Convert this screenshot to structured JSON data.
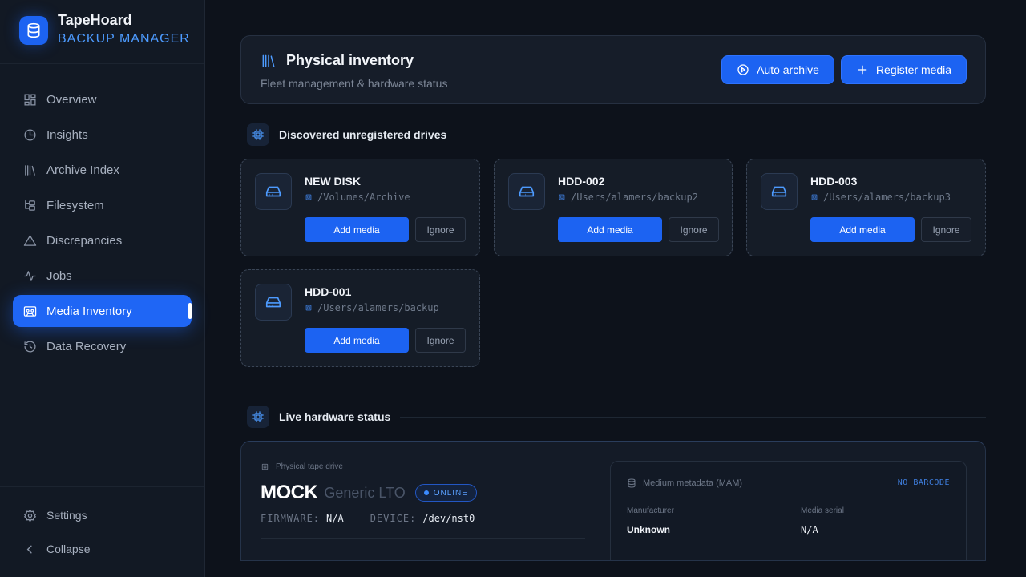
{
  "app": {
    "name": "TapeHoard",
    "subtitle": "BACKUP MANAGER"
  },
  "sidebar": {
    "items": [
      {
        "label": "Overview",
        "icon": "grid-icon"
      },
      {
        "label": "Insights",
        "icon": "pie-chart-icon"
      },
      {
        "label": "Archive Index",
        "icon": "library-icon"
      },
      {
        "label": "Filesystem",
        "icon": "folder-tree-icon"
      },
      {
        "label": "Discrepancies",
        "icon": "warning-icon"
      },
      {
        "label": "Jobs",
        "icon": "activity-icon"
      },
      {
        "label": "Media Inventory",
        "icon": "cassette-icon",
        "active": true
      },
      {
        "label": "Data Recovery",
        "icon": "history-icon"
      }
    ],
    "settings_label": "Settings",
    "collapse_label": "Collapse"
  },
  "header": {
    "title": "Physical inventory",
    "subtitle": "Fleet management & hardware status",
    "auto_archive_label": "Auto archive",
    "register_label": "Register media"
  },
  "discovered": {
    "title": "Discovered unregistered drives",
    "drives": [
      {
        "name": "NEW DISK",
        "path": "/Volumes/Archive",
        "add_label": "Add media",
        "ignore_label": "Ignore"
      },
      {
        "name": "HDD-002",
        "path": "/Users/alamers/backup2",
        "add_label": "Add media",
        "ignore_label": "Ignore"
      },
      {
        "name": "HDD-003",
        "path": "/Users/alamers/backup3",
        "add_label": "Add media",
        "ignore_label": "Ignore"
      },
      {
        "name": "HDD-001",
        "path": "/Users/alamers/backup",
        "add_label": "Add media",
        "ignore_label": "Ignore"
      }
    ]
  },
  "hardware": {
    "title": "Live hardware status",
    "drive_label": "Physical tape drive",
    "name": "MOCK",
    "model": "Generic LTO",
    "status": "ONLINE",
    "firmware_key": "FIRMWARE:",
    "firmware_value": "N/A",
    "device_key": "DEVICE:",
    "device_value": "/dev/nst0",
    "mam": {
      "title": "Medium metadata (MAM)",
      "barcode": "NO BARCODE",
      "manufacturer_label": "Manufacturer",
      "manufacturer_value": "Unknown",
      "serial_label": "Media serial",
      "serial_value": "N/A"
    }
  },
  "colors": {
    "accent": "#1c63f2",
    "accent_text": "#4d9bff",
    "background": "#0d121b",
    "sidebar": "#121924"
  }
}
